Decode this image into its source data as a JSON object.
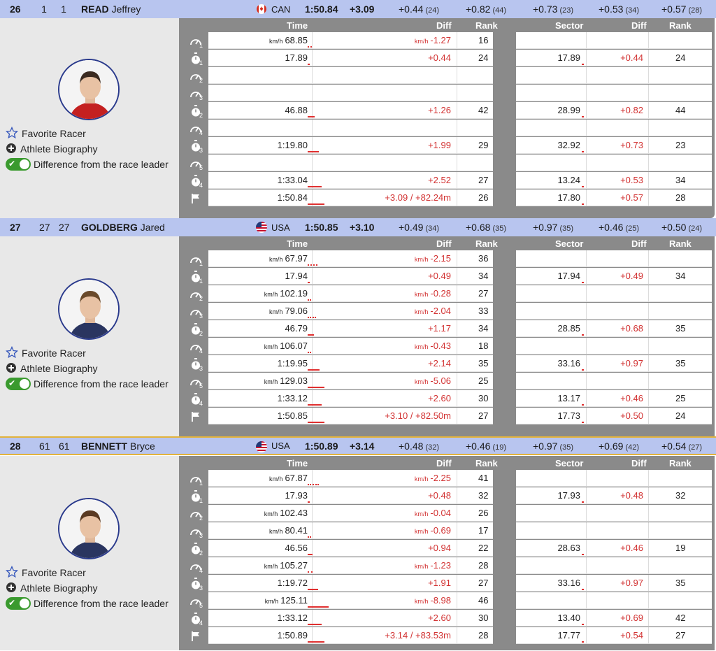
{
  "labels": {
    "favorite": "Favorite Racer",
    "biography": "Athlete Biography",
    "difference": "Difference from the race leader",
    "col_time": "Time",
    "col_diff": "Diff",
    "col_rank": "Rank",
    "col_sector": "Sector",
    "col_diff2": "Diff",
    "col_rank2": "Rank"
  },
  "colors": {
    "header_bg": "#b8c5ef",
    "diff_red": "#d23232",
    "toggle_green": "#3a9a2e",
    "grid_gray": "#8a8a8a"
  },
  "racers": [
    {
      "bib": "26",
      "n1": "1",
      "n2": "1",
      "last": "READ",
      "first": "Jeffrey",
      "nat": "CAN",
      "flag": "canada-flag-icon",
      "total": "1:50.84",
      "gap": "+3.09",
      "sectors": [
        {
          "v": "+0.44",
          "r": "(24)"
        },
        {
          "v": "+0.82",
          "r": "(44)"
        },
        {
          "v": "+0.73",
          "r": "(23)"
        },
        {
          "v": "+0.53",
          "r": "(34)"
        },
        {
          "v": "+0.57",
          "r": "(28)"
        }
      ],
      "rows": [
        {
          "icon": "speed-icon",
          "sub": "1",
          "unit": "km/h",
          "time": "68.85",
          "dunit": "km/h",
          "diff": "-1.27",
          "rank": "16",
          "sector": "",
          "sdiff": "",
          "srank": "",
          "mark": "dots",
          "mw": 6
        },
        {
          "icon": "stopwatch-icon",
          "sub": "1",
          "unit": "",
          "time": "17.89",
          "dunit": "",
          "diff": "+0.44",
          "rank": "24",
          "sector": "17.89",
          "sdiff": "+0.44",
          "srank": "24",
          "mark": "bar",
          "mw": 3
        },
        {
          "icon": "speed-icon",
          "sub": "2",
          "unit": "",
          "time": "",
          "dunit": "",
          "diff": "",
          "rank": "",
          "sector": "",
          "sdiff": "",
          "srank": "",
          "mark": "",
          "mw": 0
        },
        {
          "icon": "speed-icon",
          "sub": "3",
          "unit": "",
          "time": "",
          "dunit": "",
          "diff": "",
          "rank": "",
          "sector": "",
          "sdiff": "",
          "srank": "",
          "mark": "",
          "mw": 0
        },
        {
          "icon": "stopwatch-icon",
          "sub": "2",
          "unit": "",
          "time": "46.88",
          "dunit": "",
          "diff": "+1.26",
          "rank": "42",
          "sector": "28.99",
          "sdiff": "+0.82",
          "srank": "44",
          "mark": "bar",
          "mw": 10
        },
        {
          "icon": "speed-icon",
          "sub": "4",
          "unit": "",
          "time": "",
          "dunit": "",
          "diff": "",
          "rank": "",
          "sector": "",
          "sdiff": "",
          "srank": "",
          "mark": "",
          "mw": 0
        },
        {
          "icon": "stopwatch-icon",
          "sub": "3",
          "unit": "",
          "time": "1:19.80",
          "dunit": "",
          "diff": "+1.99",
          "rank": "29",
          "sector": "32.92",
          "sdiff": "+0.73",
          "srank": "23",
          "mark": "bar",
          "mw": 16
        },
        {
          "icon": "speed-icon",
          "sub": "5",
          "unit": "",
          "time": "",
          "dunit": "",
          "diff": "",
          "rank": "",
          "sector": "",
          "sdiff": "",
          "srank": "",
          "mark": "",
          "mw": 0
        },
        {
          "icon": "stopwatch-icon",
          "sub": "4",
          "unit": "",
          "time": "1:33.04",
          "dunit": "",
          "diff": "+2.52",
          "rank": "27",
          "sector": "13.24",
          "sdiff": "+0.53",
          "srank": "34",
          "mark": "bar",
          "mw": 20
        },
        {
          "icon": "finish-flag-icon",
          "sub": "",
          "unit": "",
          "time": "1:50.84",
          "dunit": "",
          "diff": "+3.09 / +82.24m",
          "rank": "26",
          "sector": "17.80",
          "sdiff": "+0.57",
          "srank": "28",
          "mark": "bar",
          "mw": 24
        }
      ]
    },
    {
      "bib": "27",
      "n1": "27",
      "n2": "27",
      "last": "GOLDBERG",
      "first": "Jared",
      "nat": "USA",
      "flag": "usa-flag-icon",
      "total": "1:50.85",
      "gap": "+3.10",
      "sectors": [
        {
          "v": "+0.49",
          "r": "(34)"
        },
        {
          "v": "+0.68",
          "r": "(35)"
        },
        {
          "v": "+0.97",
          "r": "(35)"
        },
        {
          "v": "+0.46",
          "r": "(25)"
        },
        {
          "v": "+0.50",
          "r": "(24)"
        }
      ],
      "rows": [
        {
          "icon": "speed-icon",
          "sub": "1",
          "unit": "km/h",
          "time": "67.97",
          "dunit": "km/h",
          "diff": "-2.15",
          "rank": "36",
          "sector": "",
          "sdiff": "",
          "srank": "",
          "mark": "dots",
          "mw": 14
        },
        {
          "icon": "stopwatch-icon",
          "sub": "1",
          "unit": "",
          "time": "17.94",
          "dunit": "",
          "diff": "+0.49",
          "rank": "34",
          "sector": "17.94",
          "sdiff": "+0.49",
          "srank": "34",
          "mark": "bar",
          "mw": 3
        },
        {
          "icon": "speed-icon",
          "sub": "2",
          "unit": "km/h",
          "time": "102.19",
          "dunit": "km/h",
          "diff": "-0.28",
          "rank": "27",
          "sector": "",
          "sdiff": "",
          "srank": "",
          "mark": "dots",
          "mw": 3
        },
        {
          "icon": "speed-icon",
          "sub": "3",
          "unit": "km/h",
          "time": "79.06",
          "dunit": "km/h",
          "diff": "-2.04",
          "rank": "33",
          "sector": "",
          "sdiff": "",
          "srank": "",
          "mark": "dots",
          "mw": 12
        },
        {
          "icon": "stopwatch-icon",
          "sub": "2",
          "unit": "",
          "time": "46.79",
          "dunit": "",
          "diff": "+1.17",
          "rank": "34",
          "sector": "28.85",
          "sdiff": "+0.68",
          "srank": "35",
          "mark": "bar",
          "mw": 9
        },
        {
          "icon": "speed-icon",
          "sub": "4",
          "unit": "km/h",
          "time": "106.07",
          "dunit": "km/h",
          "diff": "-0.43",
          "rank": "18",
          "sector": "",
          "sdiff": "",
          "srank": "",
          "mark": "dots",
          "mw": 3
        },
        {
          "icon": "stopwatch-icon",
          "sub": "3",
          "unit": "",
          "time": "1:19.95",
          "dunit": "",
          "diff": "+2.14",
          "rank": "35",
          "sector": "33.16",
          "sdiff": "+0.97",
          "srank": "35",
          "mark": "bar",
          "mw": 17
        },
        {
          "icon": "speed-icon",
          "sub": "5",
          "unit": "km/h",
          "time": "129.03",
          "dunit": "km/h",
          "diff": "-5.06",
          "rank": "25",
          "sector": "",
          "sdiff": "",
          "srank": "",
          "mark": "bar",
          "mw": 24
        },
        {
          "icon": "stopwatch-icon",
          "sub": "4",
          "unit": "",
          "time": "1:33.12",
          "dunit": "",
          "diff": "+2.60",
          "rank": "30",
          "sector": "13.17",
          "sdiff": "+0.46",
          "srank": "25",
          "mark": "bar",
          "mw": 20
        },
        {
          "icon": "finish-flag-icon",
          "sub": "",
          "unit": "",
          "time": "1:50.85",
          "dunit": "",
          "diff": "+3.10 / +82.50m",
          "rank": "27",
          "sector": "17.73",
          "sdiff": "+0.50",
          "srank": "24",
          "mark": "bar",
          "mw": 24
        }
      ]
    },
    {
      "bib": "28",
      "n1": "61",
      "n2": "61",
      "last": "BENNETT",
      "first": "Bryce",
      "nat": "USA",
      "flag": "usa-flag-icon",
      "total": "1:50.89",
      "gap": "+3.14",
      "sectors": [
        {
          "v": "+0.48",
          "r": "(32)"
        },
        {
          "v": "+0.46",
          "r": "(19)"
        },
        {
          "v": "+0.97",
          "r": "(35)"
        },
        {
          "v": "+0.69",
          "r": "(42)"
        },
        {
          "v": "+0.54",
          "r": "(27)"
        }
      ],
      "rows": [
        {
          "icon": "speed-icon",
          "sub": "1",
          "unit": "km/h",
          "time": "67.87",
          "dunit": "km/h",
          "diff": "-2.25",
          "rank": "41",
          "sector": "",
          "sdiff": "",
          "srank": "",
          "mark": "dots",
          "mw": 16
        },
        {
          "icon": "stopwatch-icon",
          "sub": "1",
          "unit": "",
          "time": "17.93",
          "dunit": "",
          "diff": "+0.48",
          "rank": "32",
          "sector": "17.93",
          "sdiff": "+0.48",
          "srank": "32",
          "mark": "bar",
          "mw": 3
        },
        {
          "icon": "speed-icon",
          "sub": "2",
          "unit": "km/h",
          "time": "102.43",
          "dunit": "km/h",
          "diff": "-0.04",
          "rank": "26",
          "sector": "",
          "sdiff": "",
          "srank": "",
          "mark": "",
          "mw": 0
        },
        {
          "icon": "speed-icon",
          "sub": "3",
          "unit": "km/h",
          "time": "80.41",
          "dunit": "km/h",
          "diff": "-0.69",
          "rank": "17",
          "sector": "",
          "sdiff": "",
          "srank": "",
          "mark": "dots",
          "mw": 3
        },
        {
          "icon": "stopwatch-icon",
          "sub": "2",
          "unit": "",
          "time": "46.56",
          "dunit": "",
          "diff": "+0.94",
          "rank": "22",
          "sector": "28.63",
          "sdiff": "+0.46",
          "srank": "19",
          "mark": "bar",
          "mw": 7
        },
        {
          "icon": "speed-icon",
          "sub": "4",
          "unit": "km/h",
          "time": "105.27",
          "dunit": "km/h",
          "diff": "-1.23",
          "rank": "28",
          "sector": "",
          "sdiff": "",
          "srank": "",
          "mark": "dots",
          "mw": 7
        },
        {
          "icon": "stopwatch-icon",
          "sub": "3",
          "unit": "",
          "time": "1:19.72",
          "dunit": "",
          "diff": "+1.91",
          "rank": "27",
          "sector": "33.16",
          "sdiff": "+0.97",
          "srank": "35",
          "mark": "bar",
          "mw": 15
        },
        {
          "icon": "speed-icon",
          "sub": "5",
          "unit": "km/h",
          "time": "125.11",
          "dunit": "km/h",
          "diff": "-8.98",
          "rank": "46",
          "sector": "",
          "sdiff": "",
          "srank": "",
          "mark": "bar",
          "mw": 30
        },
        {
          "icon": "stopwatch-icon",
          "sub": "4",
          "unit": "",
          "time": "1:33.12",
          "dunit": "",
          "diff": "+2.60",
          "rank": "30",
          "sector": "13.40",
          "sdiff": "+0.69",
          "srank": "42",
          "mark": "bar",
          "mw": 20
        },
        {
          "icon": "finish-flag-icon",
          "sub": "",
          "unit": "",
          "time": "1:50.89",
          "dunit": "",
          "diff": "+3.14 / +83.53m",
          "rank": "28",
          "sector": "17.77",
          "sdiff": "+0.54",
          "srank": "27",
          "mark": "bar",
          "mw": 24
        }
      ]
    }
  ]
}
